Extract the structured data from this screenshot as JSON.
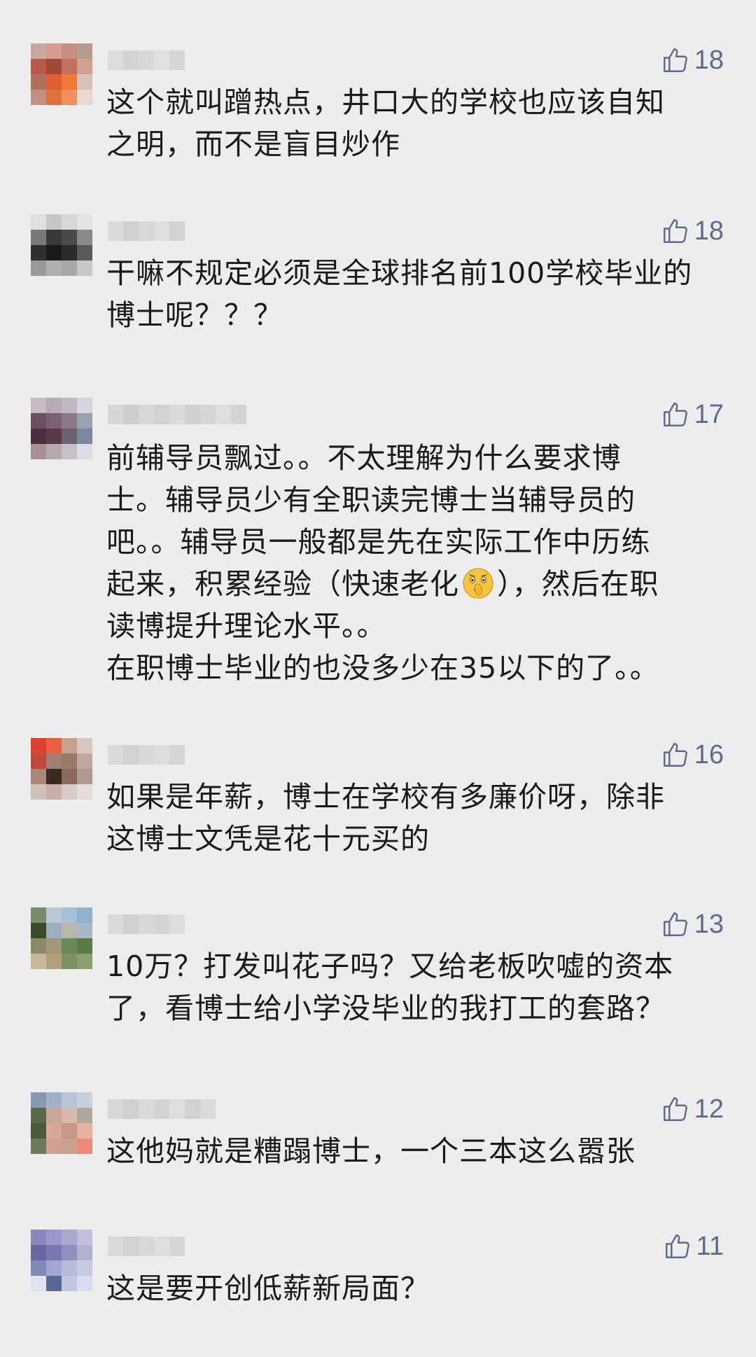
{
  "colors": {
    "background": "#ededed",
    "text": "#1a1a1a",
    "like": "#5b6c8f"
  },
  "comments": [
    {
      "likes": "18",
      "lines": [
        "这个就叫蹭热点，井口大的学校也应该自知",
        "之明，而不是盲目炒作"
      ]
    },
    {
      "likes": "18",
      "lines": [
        "干嘛不规定必须是全球排名前100学校毕业的",
        "博士呢？？？"
      ]
    },
    {
      "likes": "17",
      "lines": [
        "前辅导员飘过。。不太理解为什么要求博",
        "士。辅导员少有全职读完博士当辅导员的",
        "吧。。辅导员一般都是先在实际工作中历练",
        "起来，积累经验（快速老化",
        "），然后在职",
        "读博提升理论水平。。",
        "在职博士毕业的也没多少在35以下的了。。"
      ],
      "emoji": "shushing-face-emoji"
    },
    {
      "likes": "16",
      "lines": [
        "如果是年薪，博士在学校有多廉价呀，除非",
        "这博士文凭是花十元买的"
      ]
    },
    {
      "likes": "13",
      "lines": [
        "10万？打发叫花子吗？又给老板吹嘘的资本",
        "了，看博士给小学没毕业的我打工的套路？"
      ]
    },
    {
      "likes": "12",
      "lines": [
        "这他妈就是糟蹋博士，一个三本这么嚣张"
      ]
    },
    {
      "likes": "11",
      "lines": [
        "这是要开创低薪新局面？"
      ]
    }
  ],
  "icons": {
    "like": "thumbs-up-outline-icon"
  }
}
